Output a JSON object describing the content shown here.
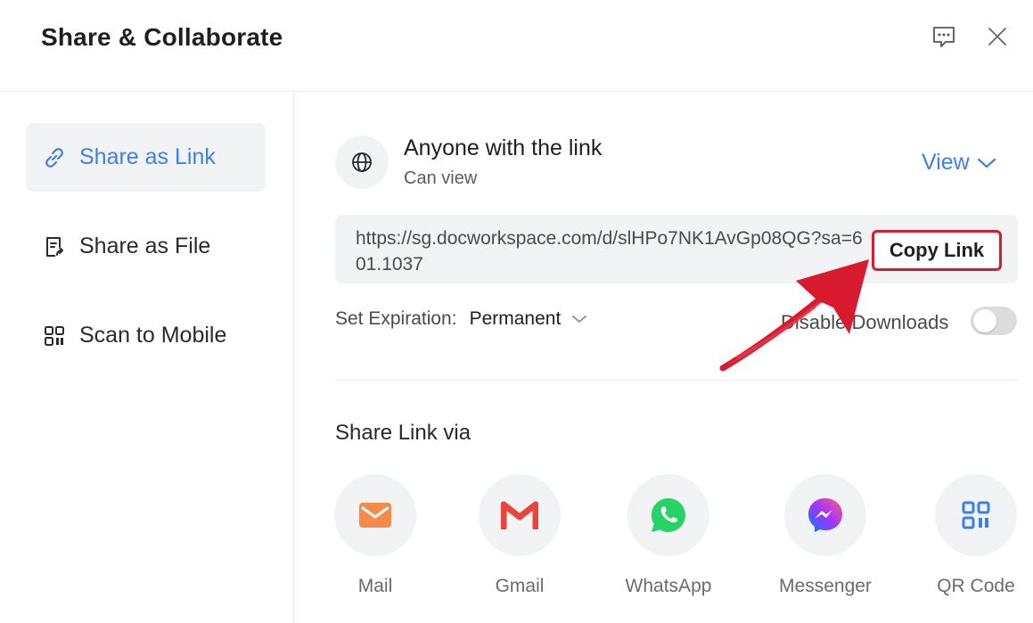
{
  "header": {
    "title": "Share & Collaborate"
  },
  "sidebar": {
    "items": [
      {
        "label": "Share as Link",
        "icon": "link-icon",
        "active": true
      },
      {
        "label": "Share as File",
        "icon": "file-share-icon",
        "active": false
      },
      {
        "label": "Scan to Mobile",
        "icon": "qr-code-icon",
        "active": false
      }
    ]
  },
  "access": {
    "title": "Anyone with the link",
    "subtitle": "Can view",
    "permission": "View"
  },
  "link": {
    "url": "https://sg.docworkspace.com/d/slHPo7NK1AvGp08QG?sa=601.1037",
    "copy_label": "Copy Link"
  },
  "expiration": {
    "label": "Set Expiration:",
    "value": "Permanent"
  },
  "downloads": {
    "label": "Disable Downloads",
    "enabled": false
  },
  "share_via": {
    "title": "Share Link via",
    "options": [
      {
        "label": "Mail",
        "icon": "mail-icon"
      },
      {
        "label": "Gmail",
        "icon": "gmail-icon"
      },
      {
        "label": "WhatsApp",
        "icon": "whatsapp-icon"
      },
      {
        "label": "Messenger",
        "icon": "messenger-icon"
      },
      {
        "label": "QR Code",
        "icon": "qr-code-icon"
      }
    ]
  },
  "colors": {
    "accent": "#3b7ff0",
    "highlight": "#d81a2f",
    "mail": "#f68a4a",
    "gmail": "#e8453c",
    "whatsapp": "#25d366",
    "messenger": "#a033ff"
  }
}
